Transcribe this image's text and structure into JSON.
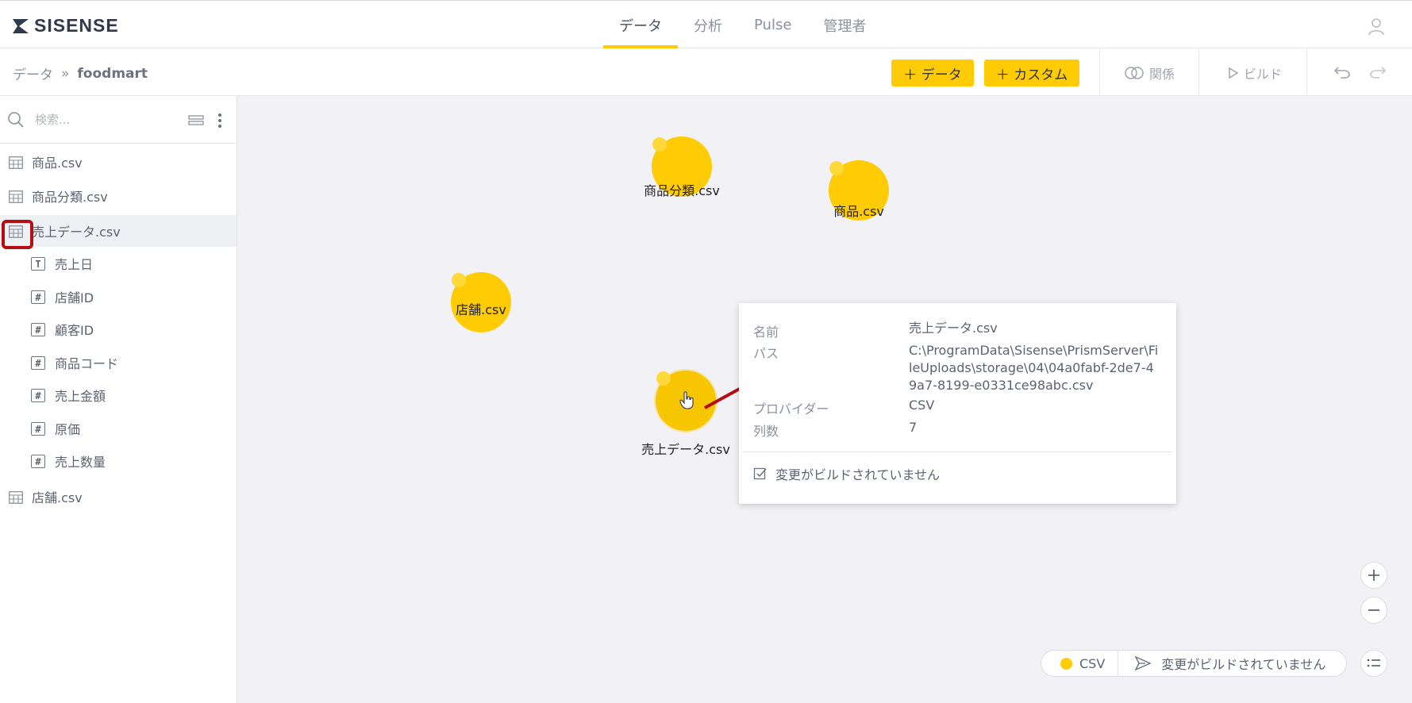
{
  "brand": {
    "name": "SISENSE"
  },
  "nav": {
    "tabs": [
      "データ",
      "分析",
      "Pulse",
      "管理者"
    ],
    "active": "データ"
  },
  "breadcrumb": {
    "root": "データ",
    "separator": "»",
    "current": "foodmart"
  },
  "toolbar": {
    "add_data": "＋ データ",
    "add_custom": "＋ カスタム",
    "relations": "関係",
    "build": "ビルド"
  },
  "search": {
    "placeholder": "検索..."
  },
  "sidebar": {
    "tables": [
      {
        "label": "商品.csv"
      },
      {
        "label": "商品分類.csv"
      },
      {
        "label": "売上データ.csv",
        "expanded": true,
        "fields": [
          {
            "label": "売上日",
            "type_icon": "T"
          },
          {
            "label": "店舗ID",
            "type_icon": "#"
          },
          {
            "label": "顧客ID",
            "type_icon": "#"
          },
          {
            "label": "商品コード",
            "type_icon": "#"
          },
          {
            "label": "売上金額",
            "type_icon": "#"
          },
          {
            "label": "原価",
            "type_icon": "#"
          },
          {
            "label": "売上数量",
            "type_icon": "#"
          }
        ]
      },
      {
        "label": "店舗.csv"
      }
    ]
  },
  "canvas": {
    "nodes": [
      {
        "label": "商品分類.csv"
      },
      {
        "label": "商品.csv"
      },
      {
        "label": "店舗.csv"
      },
      {
        "label": "売上データ.csv"
      }
    ],
    "tooltip": {
      "name_key": "名前",
      "name_value": "売上データ.csv",
      "path_key": "パス",
      "path_value": "C:\\ProgramData\\Sisense\\PrismServer\\FileUploads\\storage\\04\\04a0fabf-2de7-49a7-8199-e0331ce98abc.csv",
      "provider_key": "プロバイダー",
      "provider_value": "CSV",
      "columns_key": "列数",
      "columns_value": "7",
      "status": "変更がビルドされていません"
    }
  },
  "legend": {
    "csv": "CSV",
    "status": "変更がビルドされていません"
  },
  "colors": {
    "accent": "#ffcb05",
    "annotation": "#b20e14",
    "canvas_bg": "#f2f2f6"
  }
}
